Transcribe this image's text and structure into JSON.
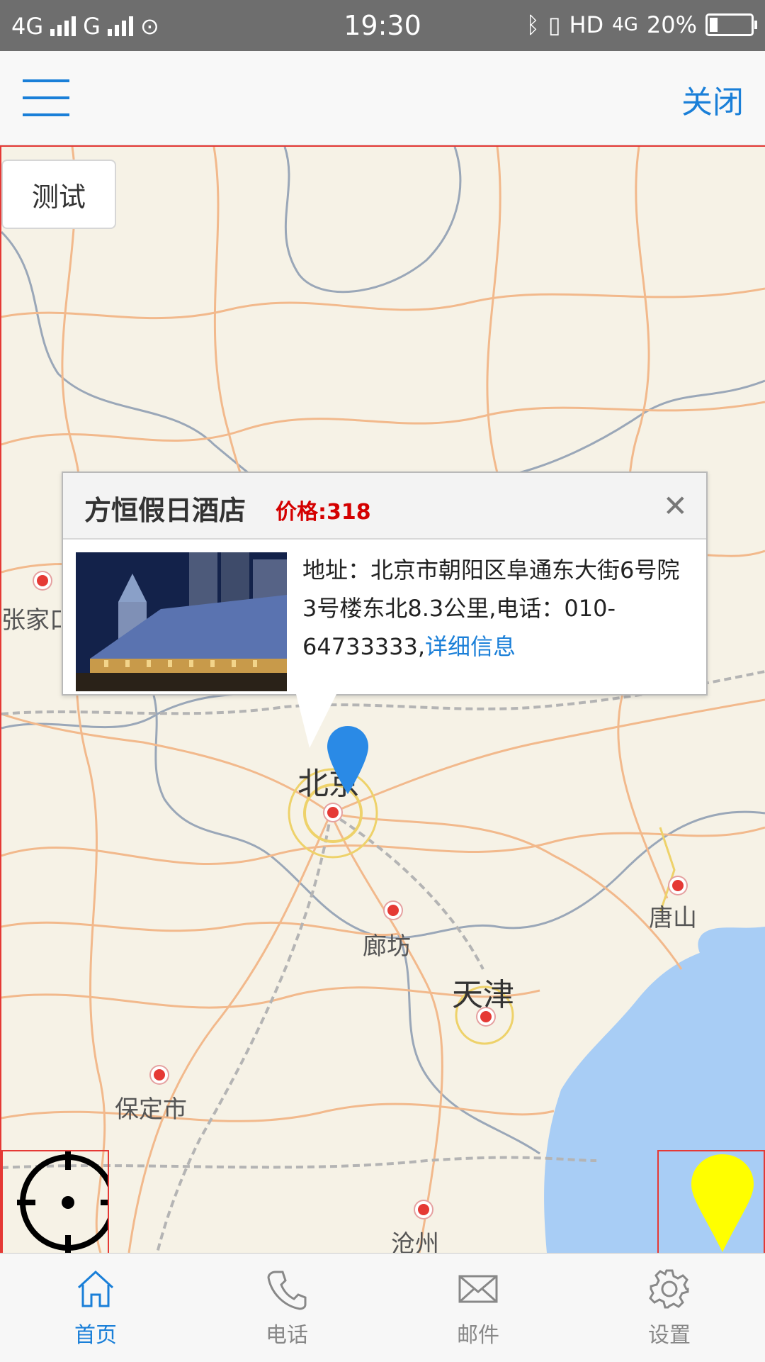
{
  "status_bar": {
    "network_1": "4G",
    "network_2": "G",
    "time": "19:30",
    "hd": "HD",
    "network_3": "4G",
    "battery": "20%",
    "battery_level": 0.2
  },
  "top_nav": {
    "close_label": "关闭"
  },
  "map": {
    "test_button_label": "测试",
    "cities": {
      "beijing": "北京",
      "zhangjiakou": "张家口",
      "tangshan": "唐山",
      "langfang": "廊坊",
      "tianjin": "天津",
      "baoding": "保定市",
      "cangzhou": "沧州"
    },
    "popup": {
      "title": "方恒假日酒店",
      "price": "价格:318",
      "close_symbol": "✕",
      "address_line": "地址：北京市朝阳区阜通东大街6号院3号楼东北8.3公里,电话：010-64733333,",
      "detail_link": "详细信息"
    }
  },
  "tabs": [
    {
      "label": "首页",
      "icon": "home-icon",
      "active": true
    },
    {
      "label": "电话",
      "icon": "phone-icon",
      "active": false
    },
    {
      "label": "邮件",
      "icon": "mail-icon",
      "active": false
    },
    {
      "label": "设置",
      "icon": "gear-icon",
      "active": false
    }
  ],
  "colors": {
    "accent": "#1a7fd8",
    "price_red": "#d40000",
    "marker_blue": "#2a8ae6",
    "pin_yellow": "#ffff00"
  }
}
